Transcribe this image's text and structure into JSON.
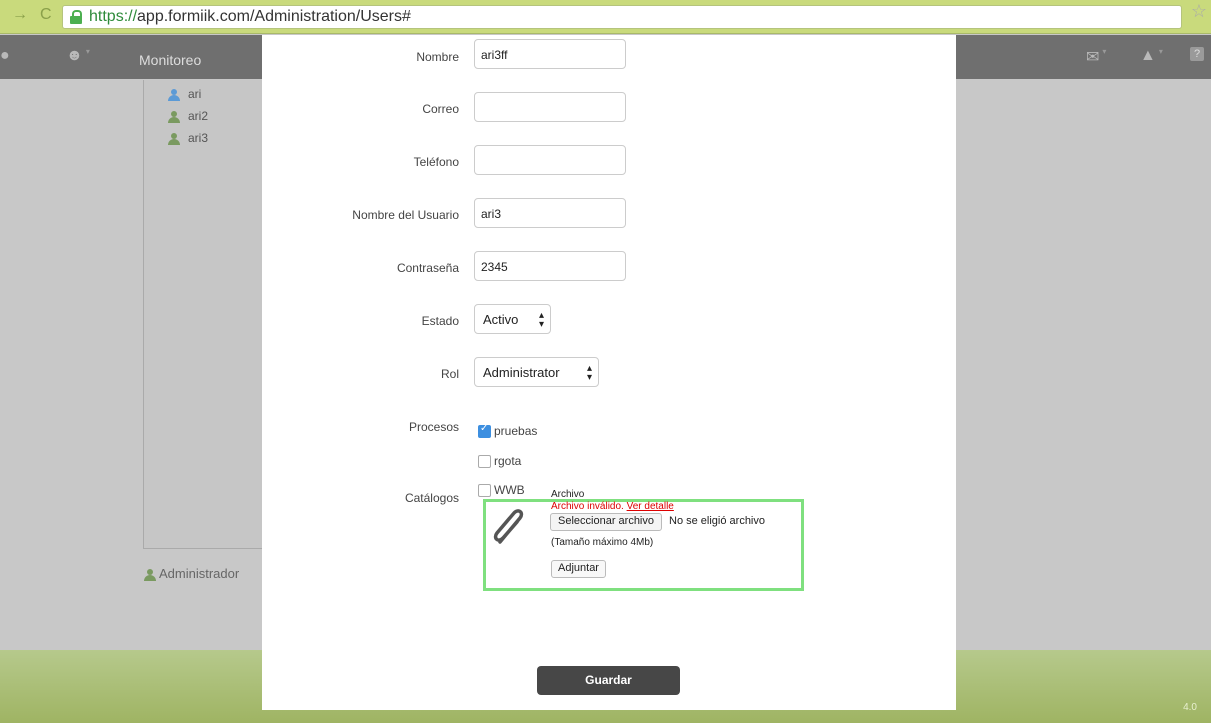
{
  "browser": {
    "url_scheme": "https://",
    "url_rest": "app.formiik.com/Administration/Users#",
    "back_glyph": "→",
    "reload_glyph": "C",
    "star_glyph": "☆"
  },
  "appbar": {
    "menu_label": "Monitoreo",
    "menu_label_hidden_char": "C"
  },
  "background": {
    "users": [
      "ari",
      "ari2",
      "ari3"
    ],
    "footer_user": "Administrador",
    "version": "4.0"
  },
  "form": {
    "nombre": {
      "label": "Nombre",
      "value": "ari3ff"
    },
    "correo": {
      "label": "Correo",
      "value": ""
    },
    "telefono": {
      "label": "Teléfono",
      "value": ""
    },
    "usuario": {
      "label": "Nombre del Usuario",
      "value": "ari3"
    },
    "contrasena": {
      "label": "Contraseña",
      "value": "2345"
    },
    "estado": {
      "label": "Estado",
      "value": "Activo"
    },
    "rol": {
      "label": "Rol",
      "value": "Administrator"
    },
    "procesos": {
      "label": "Procesos",
      "items": [
        {
          "label": "pruebas",
          "checked": true
        },
        {
          "label": "rgota",
          "checked": false
        },
        {
          "label": "WWB",
          "checked": false
        }
      ]
    },
    "catalogos": {
      "label": "Catálogos"
    },
    "file": {
      "title": "Archivo",
      "error": "Archivo inválido.",
      "error_link": "Ver detalle",
      "select_button": "Seleccionar archivo",
      "status": "No se eligió archivo",
      "max_size": "(Tamaño máximo 4Mb)",
      "attach_button": "Adjuntar"
    },
    "save_button": "Guardar"
  },
  "colors": {
    "highlight_border": "#7fe07f",
    "error": "#dd0000",
    "save_button_bg": "#474747",
    "checkbox_checked": "#3d8fe0"
  }
}
